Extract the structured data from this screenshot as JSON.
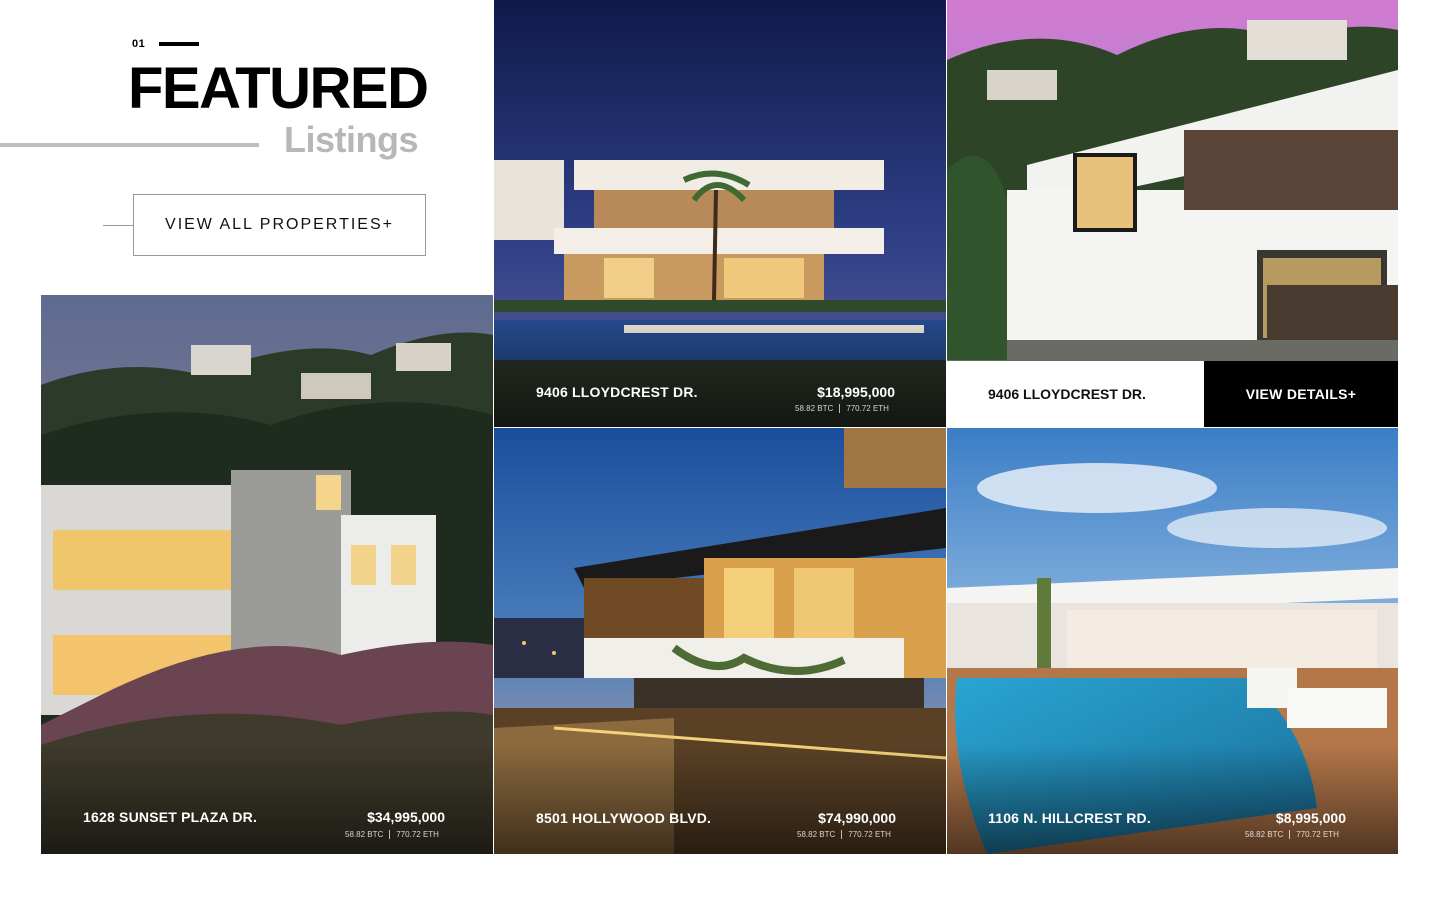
{
  "header": {
    "section_number": "01",
    "title": "FEATURED",
    "subtitle": "Listings",
    "view_all_label": "VIEW ALL PROPERTIES+"
  },
  "colors": {
    "accent": "#000000",
    "muted_title": "#b7b7b7",
    "strip_light": "#ffffff",
    "strip_dark": "#000000"
  },
  "listings": [
    {
      "address": "1628 SUNSET PLAZA DR.",
      "price": "$34,995,000",
      "btc": "58.82 BTC",
      "eth": "770.72 ETH",
      "image": "cliffside-modern-home-dusk"
    },
    {
      "address": "9406 LLOYDCREST DR.",
      "price": "$18,995,000",
      "btc": "58.82 BTC",
      "eth": "770.72 ETH",
      "image": "modern-villa-pool-night"
    },
    {
      "address": "9406 LLOYDCREST DR.",
      "details_label": "VIEW DETAILS+",
      "image": "hillside-house-garage-sunset"
    },
    {
      "address": "8501 HOLLYWOOD BLVD.",
      "price": "$74,990,000",
      "btc": "58.82 BTC",
      "eth": "770.72 ETH",
      "image": "hilltop-terrace-city-lights"
    },
    {
      "address": "1106 N. HILLCREST RD.",
      "price": "$8,995,000",
      "btc": "58.82 BTC",
      "eth": "770.72 ETH",
      "image": "courtyard-pool-daylight"
    }
  ]
}
